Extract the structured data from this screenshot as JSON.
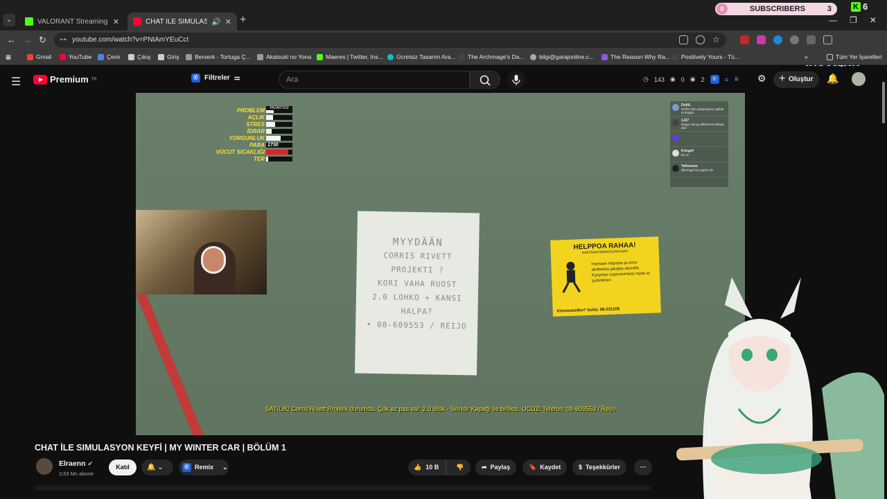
{
  "browser": {
    "tabs": [
      {
        "title": "VALORANT Streaming - Live St",
        "favicon_color": "#53fc18"
      },
      {
        "title": "CHAT İLE SIMULASYON KEYF",
        "favicon_color": "#ff0033"
      }
    ],
    "new_tab": "+",
    "url": "youtube.com/watch?v=PNtAmYEuCcI",
    "subscriber_widget": {
      "left_count": "0",
      "label": "SUBSCRIBERS",
      "right_count": "3"
    },
    "kick_count": "6",
    "extension_brand": "inovapin",
    "bookmarks": [
      {
        "label": "Gmail",
        "color": "#ea4335"
      },
      {
        "label": "YouTube",
        "color": "#ff0033"
      },
      {
        "label": "Çevir",
        "color": "#4a86e8"
      },
      {
        "label": "Çıkış",
        "color": "#cccccc"
      },
      {
        "label": "Giriş",
        "color": "#cccccc"
      },
      {
        "label": "Berserk - Tortuga Ç...",
        "color": "#999999"
      },
      {
        "label": "Akatsuki no Yona",
        "color": "#999999"
      },
      {
        "label": "Maeres | Twitter, Ins...",
        "color": "#53fc18"
      },
      {
        "label": "Ücretsiz Tasarım Ara...",
        "color": "#00c4cc"
      },
      {
        "label": "The Archmage's Da...",
        "color": "#444444"
      },
      {
        "label": "bilgi@garajonline.c...",
        "color": "#aaaaaa"
      },
      {
        "label": "The Reason Why Ra...",
        "color": "#8a5ad8"
      },
      {
        "label": "Positively Yours - Tü...",
        "color": "#444444"
      }
    ],
    "all_bookmarks": "Tüm Yer İşaretleri"
  },
  "youtube": {
    "logo_text": "Premium",
    "logo_region": "TR",
    "filters_label": "Filtreler",
    "search_placeholder": "Ara",
    "stats": {
      "views": "143",
      "a": "0",
      "b": "2"
    },
    "create_label": "Oluştur"
  },
  "video": {
    "hud": {
      "day": "PAZARTESİ",
      "rows": [
        {
          "label": "PROBLEM",
          "level": 0.3
        },
        {
          "label": "AÇLIK",
          "level": 0.25
        },
        {
          "label": "STRES",
          "level": 0.35
        },
        {
          "label": "İDRAR",
          "level": 0.2
        },
        {
          "label": "YORGUNLUK",
          "level": 0.55
        },
        {
          "label": "PARA",
          "value": "1730"
        },
        {
          "label": "VÜCUT SICAKLIĞI",
          "level": 0.85,
          "color": "#e0202a"
        },
        {
          "label": "TER",
          "level": 0.08
        }
      ]
    },
    "note_lines": [
      "MYYDÄÄN",
      "CORRIS RIVETT",
      "PROJEKTI ?",
      "KORI VAHA RUOST",
      "2.0 LOHKO + KANSI",
      "HALPA?",
      "• 08-609553 / REIJO"
    ],
    "ad": {
      "title": "HELPPOA RAHAA!",
      "subtitle": "HAETAAN MAINOSJAKAJAA",
      "body": "Haetaan reipasta ja oma-aloitteista jakajaa alueelle. Kysymys sopeutumista myös ei puhelimen",
      "phone": "Kiinnostuitko? Soita: 08-231206"
    },
    "subtitle": "SATILIK! Corris Rivett Projelik durumda. Çok az pas var. 2.0 Blok - Silindir Kapağı ile birlikte. UCUZ! Telefon: 08-609553 / Reijo",
    "chat": [
      {
        "user": "DoliiL",
        "msg": "sel'hm don çalışmıyoruz girilde mi bugün",
        "color": "#7a9cd8"
      },
      {
        "user": "1.6i7",
        "msg": "Kargo olunup dikerniniz kafaya alor",
        "color": "#444"
      },
      {
        "user": "",
        "msg": "",
        "color": "#6a3ad8"
      },
      {
        "user": "Kringof",
        "msg": "bu ne",
        "color": "#ddd"
      },
      {
        "user": "Tallsemee",
        "msg": "@Kringof Ha yaptın Ab",
        "color": "#222"
      }
    ]
  },
  "meta": {
    "title": "CHAT İLE SIMULASYON KEYFİ | MY WINTER CAR | BÖLÜM 1",
    "channel": "Elraenn",
    "subscribers": "3,53 Mn abone",
    "join_label": "Katıl",
    "remix_label": "Remix",
    "likes": "10 B",
    "share_label": "Paylaş",
    "save_label": "Kaydet",
    "thanks_label": "Teşekkürler",
    "more_label": "···"
  }
}
